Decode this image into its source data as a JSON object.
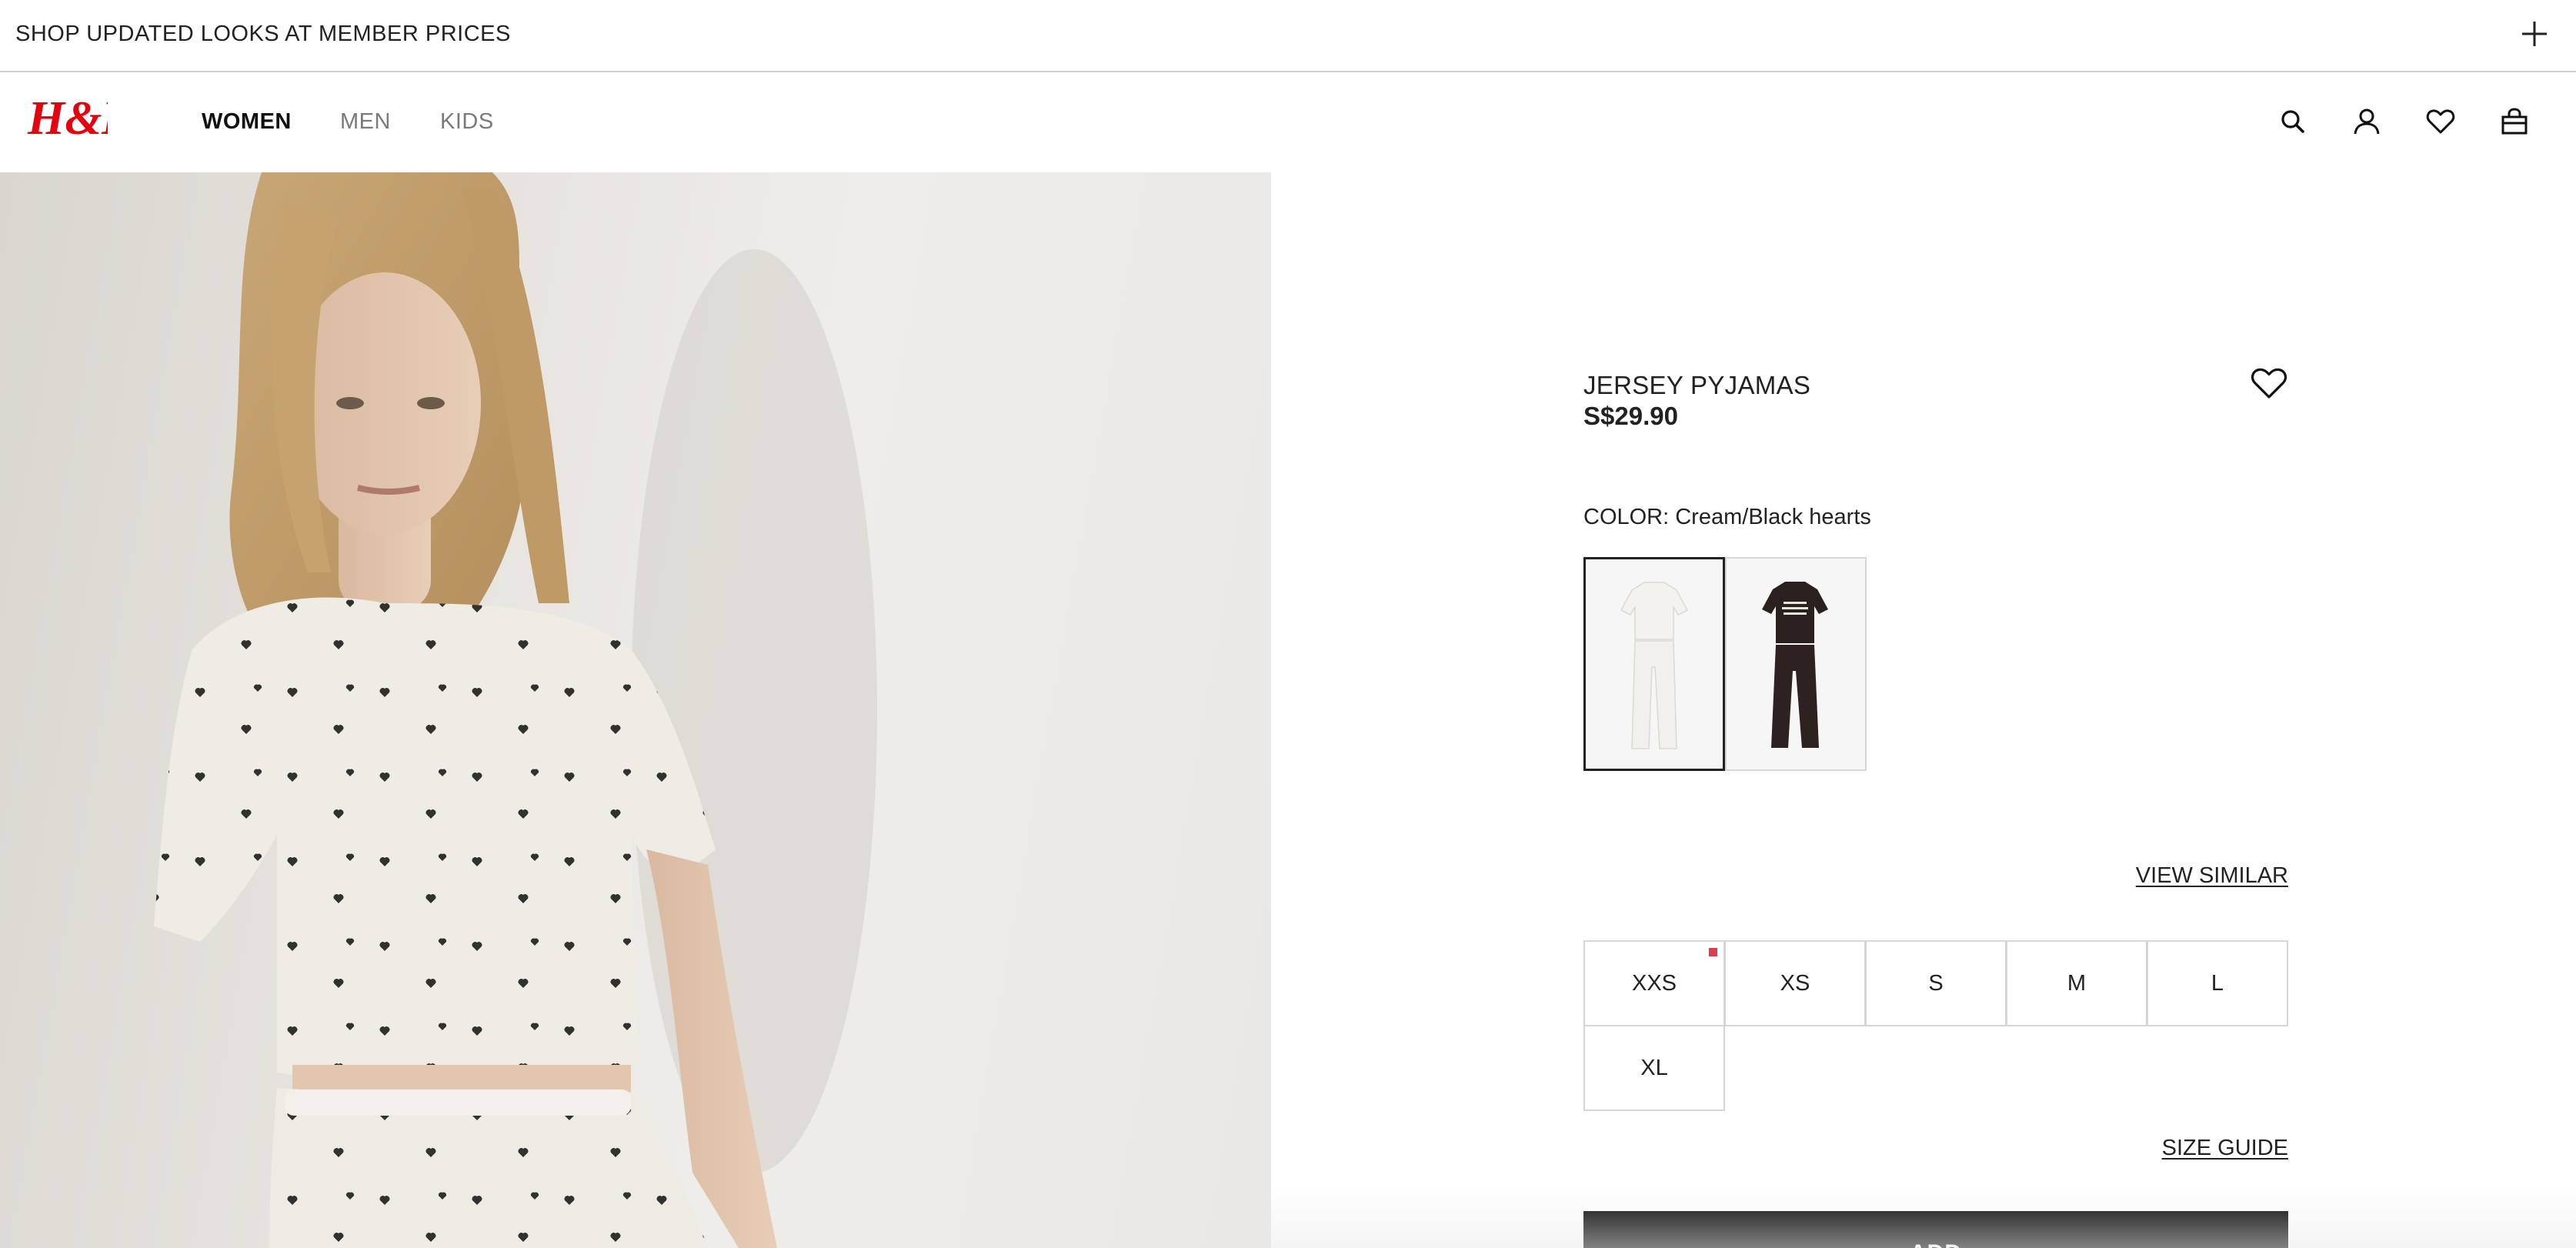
{
  "promo": {
    "text": "SHOP UPDATED LOOKS AT MEMBER PRICES",
    "expand_icon": "plus-icon"
  },
  "header": {
    "logo": "H&M",
    "nav": [
      {
        "label": "WOMEN",
        "active": true
      },
      {
        "label": "MEN",
        "active": false
      },
      {
        "label": "KIDS",
        "active": false
      }
    ],
    "icons": [
      "search-icon",
      "account-icon",
      "favorites-icon",
      "bag-icon"
    ]
  },
  "product": {
    "title": "JERSEY PYJAMAS",
    "price": "S$29.90",
    "color_label": "COLOR: Cream/Black hearts",
    "swatches": [
      {
        "name": "Cream/Black hearts",
        "selected": true
      },
      {
        "name": "Dark brown",
        "selected": false
      }
    ],
    "view_similar": "VIEW SIMILAR",
    "sizes": [
      {
        "label": "XXS",
        "low_stock": true
      },
      {
        "label": "XS",
        "low_stock": false
      },
      {
        "label": "S",
        "low_stock": false
      },
      {
        "label": "M",
        "low_stock": false
      },
      {
        "label": "L",
        "low_stock": false
      },
      {
        "label": "XL",
        "low_stock": false
      }
    ],
    "size_guide": "SIZE GUIDE",
    "add_button": "ADD"
  },
  "colors": {
    "brand_red": "#e50010",
    "low_stock_dot": "#d9404d",
    "button_bg": "#000000"
  }
}
